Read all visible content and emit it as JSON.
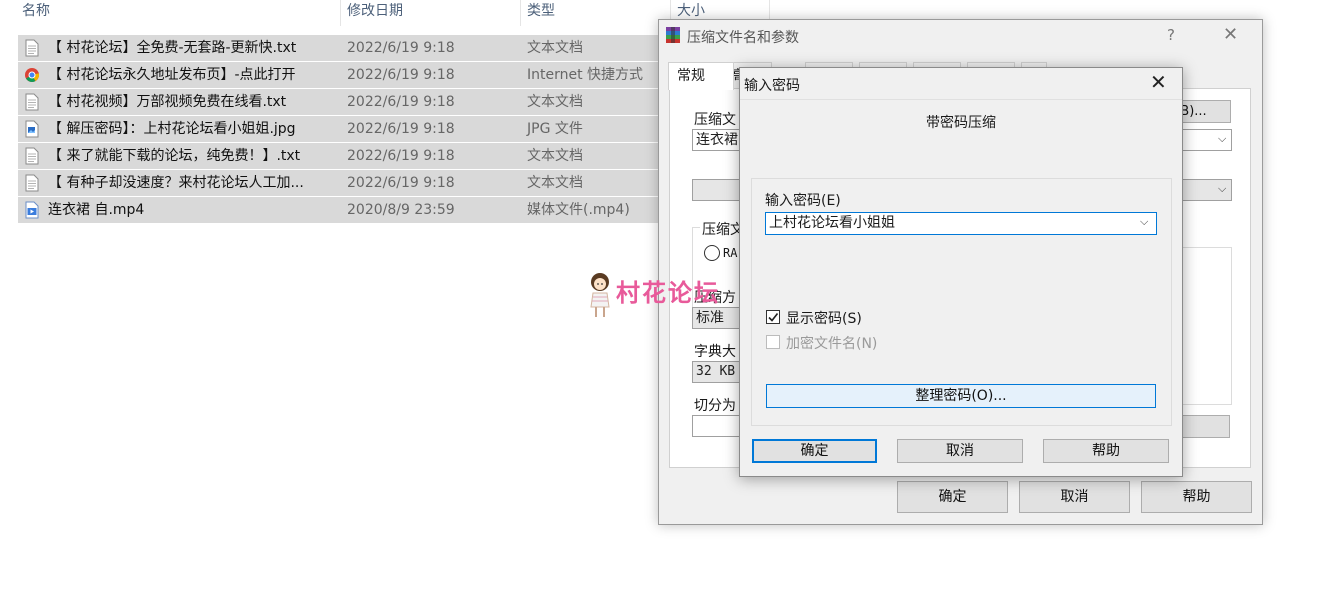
{
  "explorer": {
    "columns": {
      "name": "名称",
      "modified": "修改日期",
      "type": "类型",
      "size": "大小"
    },
    "files": [
      {
        "name": "【 村花论坛】全免费-无套路-更新快.txt",
        "modified": "2022/6/19 9:18",
        "type": "文本文档",
        "icon": "text-file-icon"
      },
      {
        "name": "【 村花论坛永久地址发布页】-点此打开",
        "modified": "2022/6/19 9:18",
        "type": "Internet 快捷方式",
        "icon": "chrome-shortcut-icon"
      },
      {
        "name": "【 村花视频】万部视频免费在线看.txt",
        "modified": "2022/6/19 9:18",
        "type": "文本文档",
        "icon": "text-file-icon"
      },
      {
        "name": "【 解压密码】：上村花论坛看小姐姐.jpg",
        "modified": "2022/6/19 9:18",
        "type": "JPG 文件",
        "icon": "image-file-icon"
      },
      {
        "name": "【 来了就能下载的论坛，纯免费！】.txt",
        "modified": "2022/6/19 9:18",
        "type": "文本文档",
        "icon": "text-file-icon"
      },
      {
        "name": "【 有种子却没速度？来村花论坛人工加...",
        "modified": "2022/6/19 9:18",
        "type": "文本文档",
        "icon": "text-file-icon"
      },
      {
        "name": "连衣裙 自.mp4",
        "modified": "2020/8/9 23:59",
        "type": "媒体文件(.mp4)",
        "icon": "video-file-icon"
      }
    ]
  },
  "archive_dialog": {
    "title": "压缩文件名和参数",
    "help_glyph": "?",
    "tabs": [
      "常规",
      "高"
    ],
    "archive_name_label": "压缩文",
    "archive_name_value": "连衣裙",
    "browse_label": "B)...",
    "format_label": "压缩文",
    "format_option": "RA",
    "method_label": "压缩方",
    "method_value": "标准",
    "dict_label": "字典大",
    "dict_value": "32 KB",
    "split_label": "切分为",
    "ok": "确定",
    "cancel": "取消",
    "help": "帮助"
  },
  "password_dialog": {
    "title": "输入密码",
    "heading": "带密码压缩",
    "enter_label": "输入密码(E)",
    "password_value": "上村花论坛看小姐姐",
    "show_password": {
      "label": "显示密码(S)",
      "checked": true
    },
    "encrypt_names": {
      "label": "加密文件名(N)",
      "checked": false,
      "disabled": true
    },
    "organize_button": "整理密码(O)...",
    "ok": "确定",
    "cancel": "取消",
    "help": "帮助"
  },
  "watermark": {
    "text": "村花论坛"
  }
}
